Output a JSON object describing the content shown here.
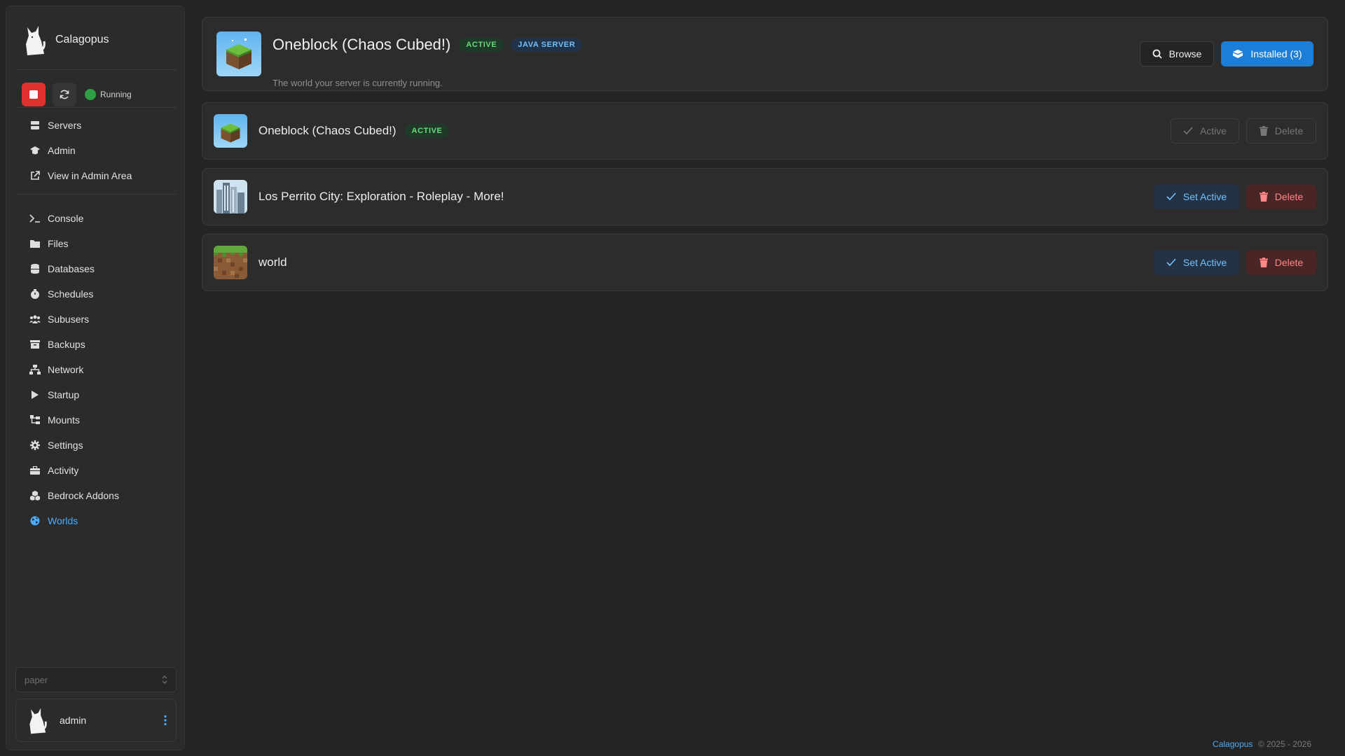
{
  "app": {
    "name": "Calagopus"
  },
  "server_status": {
    "label": "Running",
    "color": "#2f9e44"
  },
  "nav_top": [
    {
      "label": "Servers",
      "icon": "servers-icon"
    },
    {
      "label": "Admin",
      "icon": "admin-icon"
    },
    {
      "label": "View in Admin Area",
      "icon": "external-link-icon"
    }
  ],
  "nav_main": [
    {
      "label": "Console",
      "icon": "terminal-icon"
    },
    {
      "label": "Files",
      "icon": "folder-icon"
    },
    {
      "label": "Databases",
      "icon": "database-icon"
    },
    {
      "label": "Schedules",
      "icon": "stopwatch-icon"
    },
    {
      "label": "Subusers",
      "icon": "users-icon"
    },
    {
      "label": "Backups",
      "icon": "archive-icon"
    },
    {
      "label": "Network",
      "icon": "network-icon"
    },
    {
      "label": "Startup",
      "icon": "play-icon"
    },
    {
      "label": "Mounts",
      "icon": "mounts-icon"
    },
    {
      "label": "Settings",
      "icon": "gear-icon"
    },
    {
      "label": "Activity",
      "icon": "briefcase-icon"
    },
    {
      "label": "Bedrock Addons",
      "icon": "cubes-icon"
    },
    {
      "label": "Worlds",
      "icon": "globe-icon",
      "active": true
    }
  ],
  "server_select": {
    "value": "paper"
  },
  "user": {
    "name": "admin"
  },
  "header": {
    "title": "Oneblock (Chaos Cubed!)",
    "badge_active": "ACTIVE",
    "badge_type": "JAVA SERVER",
    "subtitle": "The world your server is currently running.",
    "browse_label": "Browse",
    "installed_label": "Installed (3)"
  },
  "worlds": [
    {
      "name": "Oneblock (Chaos Cubed!)",
      "active": true,
      "badge": "ACTIVE",
      "primary_label": "Active",
      "delete_label": "Delete"
    },
    {
      "name": "Los Perrito City: Exploration - Roleplay - More!",
      "active": false,
      "primary_label": "Set Active",
      "delete_label": "Delete"
    },
    {
      "name": "world",
      "active": false,
      "primary_label": "Set Active",
      "delete_label": "Delete"
    }
  ],
  "footer": {
    "brand": "Calagopus",
    "copyright": "© 2025 - 2026"
  },
  "colors": {
    "accent": "#1c7ed6",
    "active_text": "#4dabf7",
    "danger": "#e03131",
    "success": "#69db7c"
  }
}
